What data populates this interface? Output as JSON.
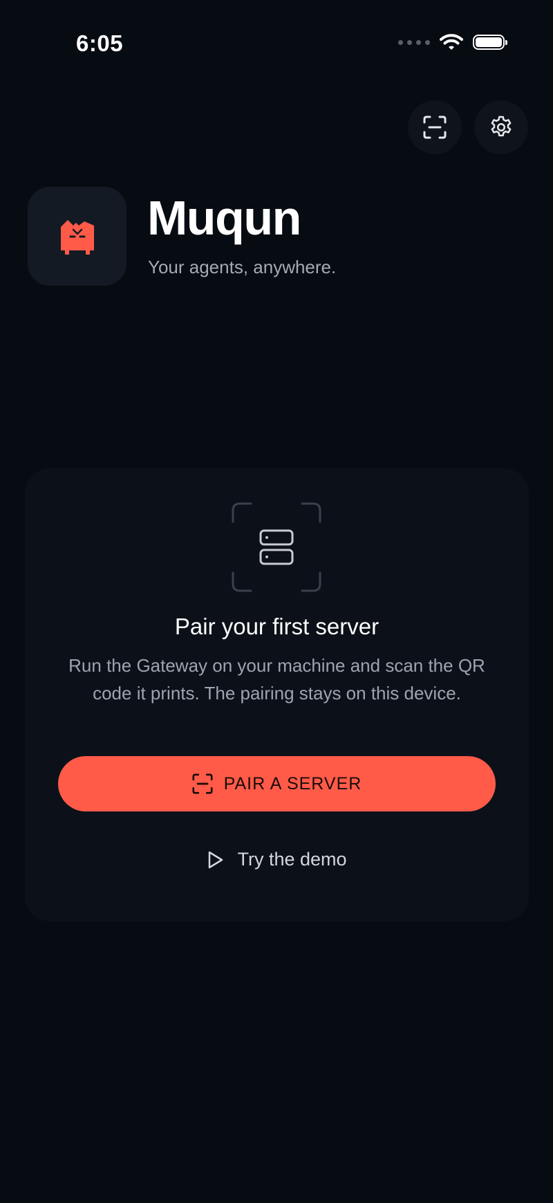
{
  "status_bar": {
    "time": "6:05",
    "battery_level": 1.0
  },
  "top_actions": {
    "scan_icon": "scan-icon",
    "settings_icon": "gear-icon"
  },
  "header": {
    "app_name": "Muqun",
    "tagline": "Your agents, anywhere."
  },
  "pair_card": {
    "icon": "server-icon",
    "title": "Pair your first server",
    "description": "Run the Gateway on your machine and scan the QR code it prints. The pairing stays on this device.",
    "primary_button_label": "PAIR A SERVER",
    "secondary_link_label": "Try the demo"
  },
  "colors": {
    "background": "#070b12",
    "card": "#0c1119",
    "accent": "#ff5b48"
  }
}
